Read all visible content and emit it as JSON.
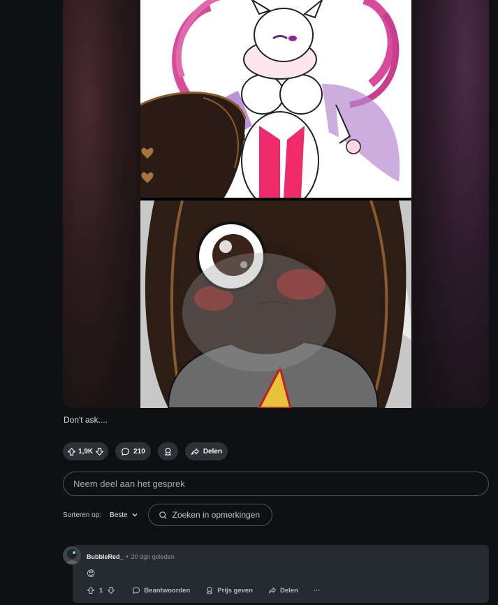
{
  "post": {
    "caption": "Don't ask...."
  },
  "actions": {
    "votes": "1,9K",
    "comments": "210",
    "share": "Delen"
  },
  "join": {
    "placeholder": "Neem deel aan het gesprek"
  },
  "sort": {
    "label": "Sorteren op:",
    "selected": "Beste",
    "search_placeholder": "Zoeken in opmerkingen"
  },
  "comment": {
    "username": "BubbleRed_",
    "separator": "•",
    "time": "20 dgn geleden",
    "body": "😍",
    "votes": "1",
    "reply": "Beantwoorden",
    "award": "Prijs geven",
    "share": "Delen",
    "more": "···"
  },
  "colors": {
    "background": "#0e1113",
    "pill": "#2a3236",
    "comment_bg": "#252b2f"
  }
}
